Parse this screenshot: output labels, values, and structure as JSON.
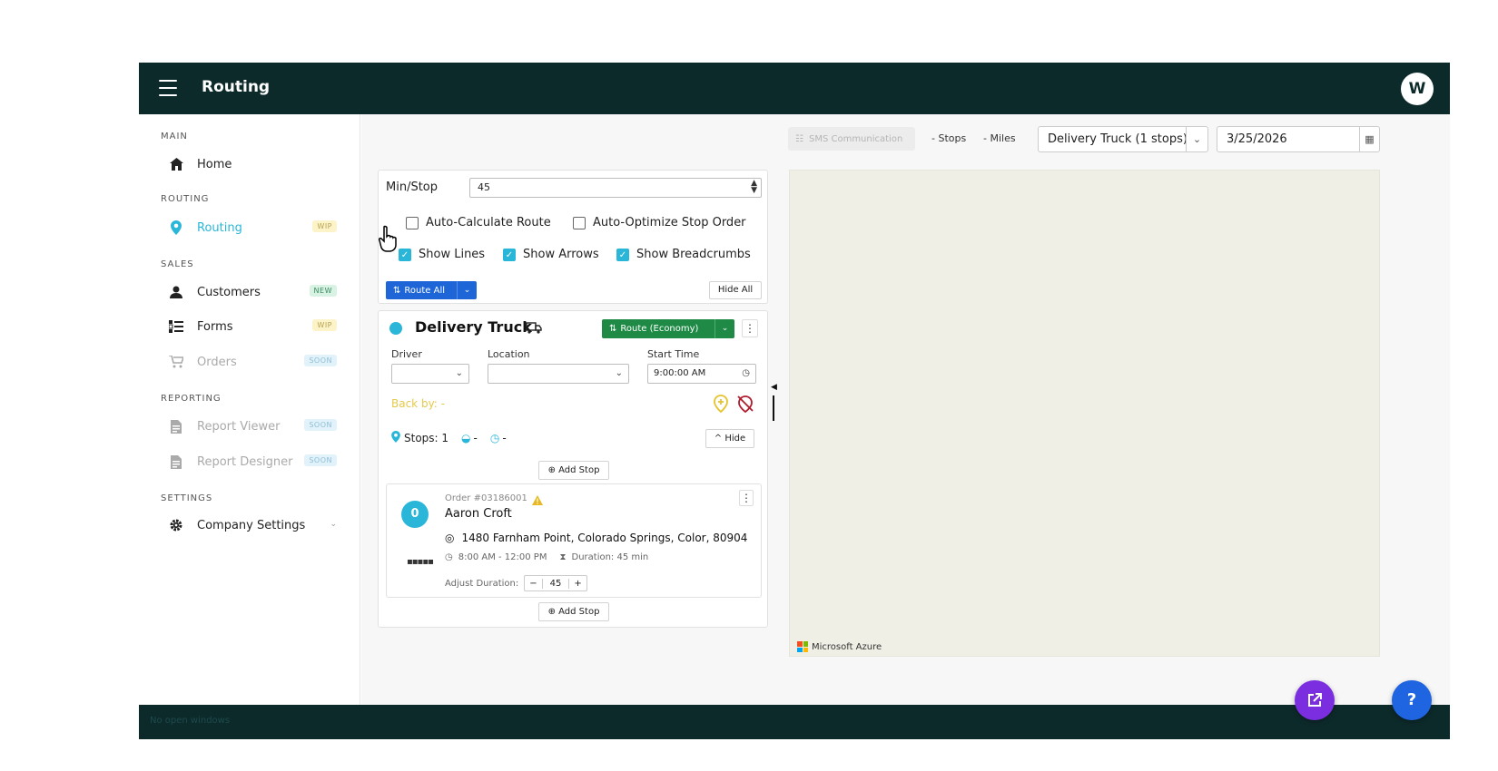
{
  "header": {
    "title": "Routing",
    "avatar_initial": "W"
  },
  "sidebar": {
    "sections": {
      "main": "MAIN",
      "routing": "ROUTING",
      "sales": "SALES",
      "reporting": "REPORTING",
      "settings": "SETTINGS"
    },
    "items": {
      "home": {
        "label": "Home"
      },
      "routing": {
        "label": "Routing",
        "badge": "WIP"
      },
      "customers": {
        "label": "Customers",
        "badge": "NEW"
      },
      "forms": {
        "label": "Forms",
        "badge": "WIP"
      },
      "orders": {
        "label": "Orders",
        "badge": "SOON"
      },
      "report_viewer": {
        "label": "Report Viewer",
        "badge": "SOON"
      },
      "report_designer": {
        "label": "Report Designer",
        "badge": "SOON"
      },
      "company_settings": {
        "label": "Company Settings"
      }
    }
  },
  "toolbar": {
    "sms_label": "SMS Communication",
    "stops_label": "- Stops",
    "miles_label": "- Miles",
    "vehicle_select": "Delivery Truck (1 stops)",
    "date": "3/25/2026"
  },
  "options": {
    "min_stop_label": "Min/Stop",
    "min_stop_value": "45",
    "auto_calc_label": "Auto-Calculate Route",
    "auto_optimize_label": "Auto-Optimize Stop Order",
    "show_lines_label": "Show Lines",
    "show_arrows_label": "Show Arrows",
    "show_breadcrumbs_label": "Show Breadcrumbs",
    "route_all_label": "Route All",
    "hide_all_label": "Hide All"
  },
  "vehicle": {
    "name": "Delivery Truck",
    "route_button_label": "Route (Economy)",
    "driver_label": "Driver",
    "location_label": "Location",
    "start_time_label": "Start Time",
    "start_time_value": "9:00:00 AM",
    "back_by_label": "Back by: -",
    "stops_label": "Stops: 1",
    "stat_dash_1": "-",
    "stat_dash_2": "-",
    "hide_label": "Hide",
    "add_stop_label": "Add Stop"
  },
  "stop": {
    "number": "0",
    "order_no": "Order #03186001",
    "customer": "Aaron Croft",
    "address": "1480 Farnham Point, Colorado Springs, Color, 80904",
    "time_window": "8:00 AM - 12:00 PM",
    "duration": "Duration: 45 min",
    "adjust_label": "Adjust Duration:",
    "adjust_value": "45",
    "minus": "−",
    "plus": "+"
  },
  "map": {
    "attribution": "Microsoft Azure"
  },
  "footer": {
    "status": "No open windows"
  },
  "colors": {
    "header_bg": "#0d2a2b",
    "accent": "#29b6d8",
    "route_all_blue": "#1e66d8",
    "route_green": "#1e8a46",
    "fab_purple": "#7a2ee0",
    "fab_blue": "#1f64e0"
  },
  "fab": {
    "help_label": "?"
  }
}
